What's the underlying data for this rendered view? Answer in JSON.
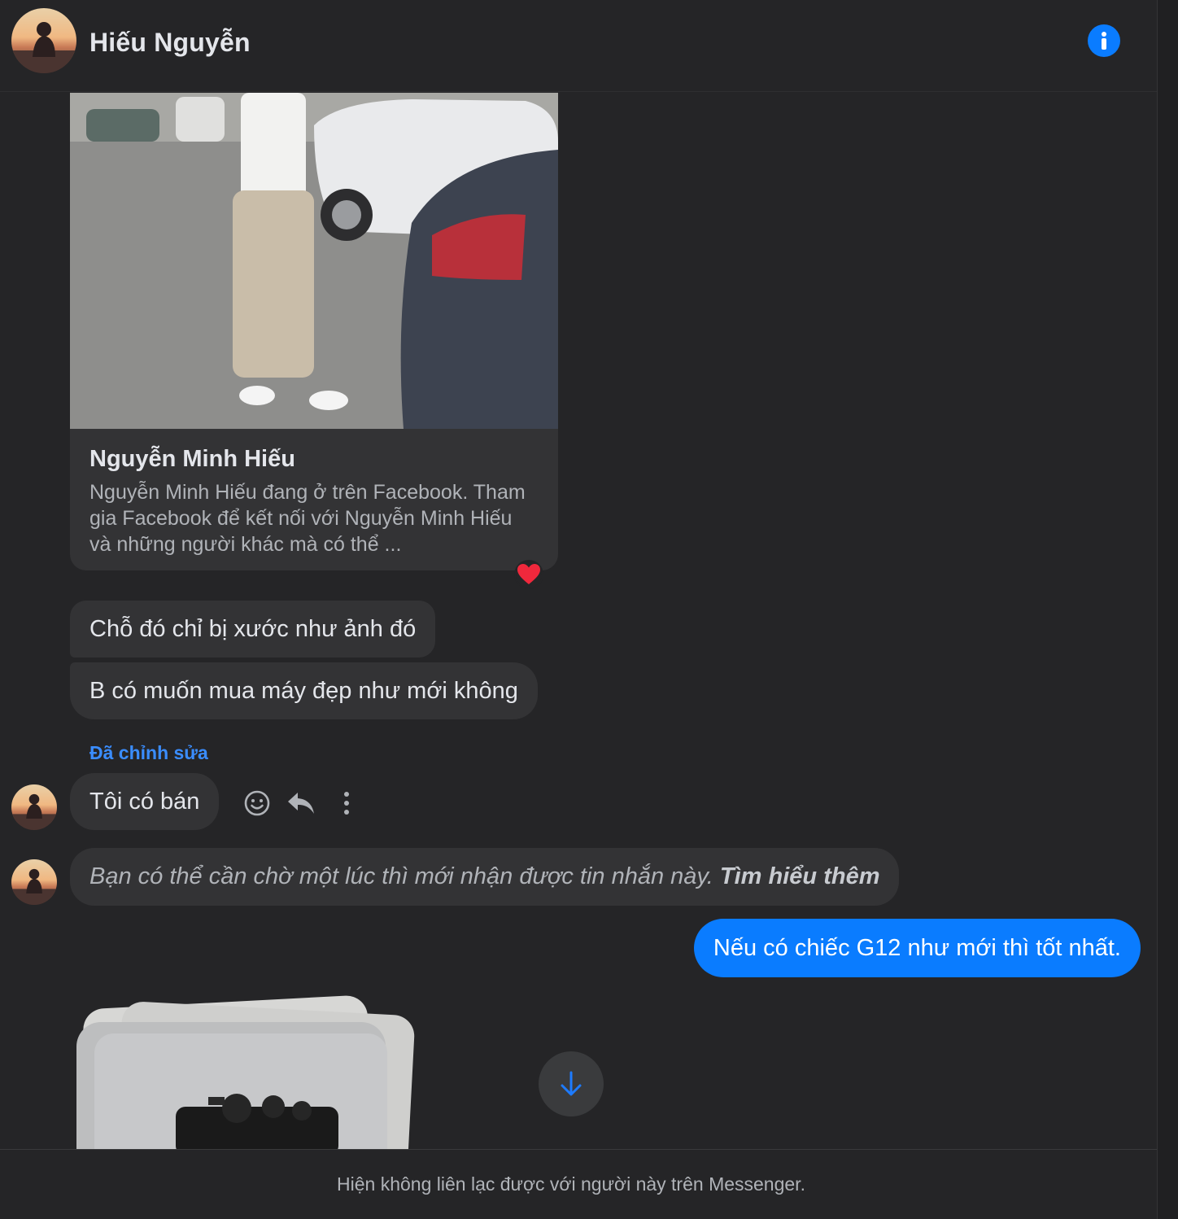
{
  "header": {
    "contact_name": "Hiếu Nguyễn",
    "info_icon": "info-icon"
  },
  "link_preview": {
    "title": "Nguyễn Minh Hiếu",
    "description": "Nguyễn Minh Hiếu đang ở trên Facebook. Tham gia Facebook để kết nối với Nguyễn Minh Hiếu và những người khác mà có thể ...",
    "reaction": "heart"
  },
  "messages": {
    "incoming_1": "Chỗ đó chỉ bị xước như ảnh đó",
    "incoming_2": "B có muốn mua máy đẹp như mới không",
    "edited_label": "Đã chỉnh sửa",
    "incoming_3": "Tôi có bán",
    "notice_text": "Bạn có thể cần chờ một lúc thì mới nhận được tin nhắn này.",
    "notice_link": "Tìm hiểu thêm",
    "outgoing_1": "Nếu có chiếc G12 như mới thì tốt nhất."
  },
  "message_actions": [
    "react-icon",
    "reply-icon",
    "more-icon"
  ],
  "footer": {
    "status_text": "Hiện không liên lạc được với người này trên Messenger."
  },
  "colors": {
    "background": "#252527",
    "bubble_incoming": "#333335",
    "bubble_outgoing": "#0a7cff",
    "accent": "#0a7cff",
    "edited_label": "#3a8dff"
  }
}
